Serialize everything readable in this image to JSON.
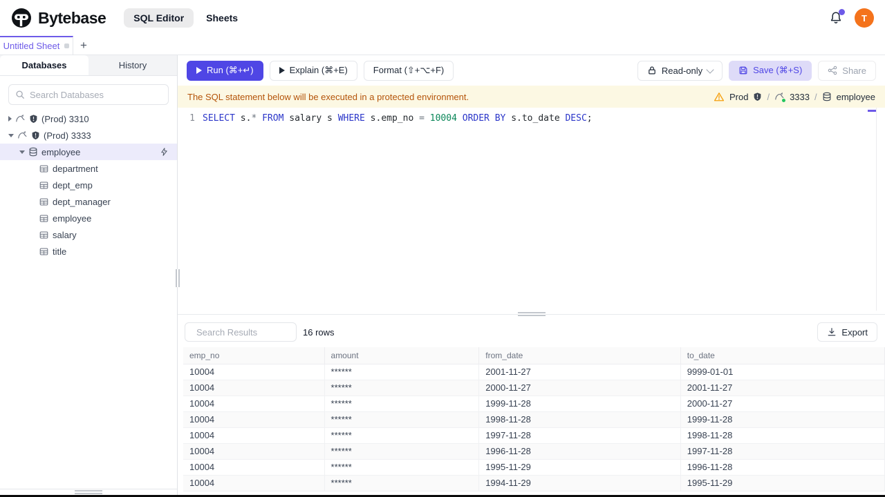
{
  "header": {
    "brand": "Bytebase",
    "nav": [
      {
        "label": "SQL Editor",
        "active": true
      },
      {
        "label": "Sheets",
        "active": false
      }
    ],
    "avatar_initial": "T"
  },
  "sheet_tabs": {
    "active_tab": "Untitled Sheet",
    "add_label": "+"
  },
  "sidebar": {
    "tabs": {
      "databases": "Databases",
      "history": "History"
    },
    "search_placeholder": "Search Databases",
    "instances": [
      {
        "label": "(Prod) 3310",
        "expanded": false
      },
      {
        "label": "(Prod) 3333",
        "expanded": true
      }
    ],
    "database": "employee",
    "tables": [
      "department",
      "dept_emp",
      "dept_manager",
      "employee",
      "salary",
      "title"
    ]
  },
  "toolbar": {
    "run_label": "Run (⌘+↵)",
    "explain_label": "Explain (⌘+E)",
    "format_label": "Format (⇧+⌥+F)",
    "mode_label": "Read-only",
    "save_label": "Save (⌘+S)",
    "share_label": "Share"
  },
  "banner": {
    "message": "The SQL statement below will be executed in a protected environment.",
    "environment": "Prod",
    "separator": "/",
    "instance": "3333",
    "database": "employee"
  },
  "editor": {
    "line_number": "1",
    "statement": "SELECT s.* FROM salary s WHERE s.emp_no = 10004 ORDER BY s.to_date DESC;",
    "tokens": [
      {
        "text": "SELECT",
        "type": "keyword"
      },
      {
        "text": " s.",
        "type": "plain"
      },
      {
        "text": "*",
        "type": "operator"
      },
      {
        "text": " ",
        "type": "plain"
      },
      {
        "text": "FROM",
        "type": "keyword"
      },
      {
        "text": " salary s ",
        "type": "plain"
      },
      {
        "text": "WHERE",
        "type": "keyword"
      },
      {
        "text": " s.emp_no ",
        "type": "plain"
      },
      {
        "text": "=",
        "type": "operator"
      },
      {
        "text": " ",
        "type": "plain"
      },
      {
        "text": "10004",
        "type": "number"
      },
      {
        "text": " ",
        "type": "plain"
      },
      {
        "text": "ORDER BY",
        "type": "keyword"
      },
      {
        "text": " s.to_date ",
        "type": "plain"
      },
      {
        "text": "DESC",
        "type": "keyword"
      },
      {
        "text": ";",
        "type": "plain"
      }
    ]
  },
  "results": {
    "search_placeholder": "Search Results",
    "row_count": "16 rows",
    "export_label": "Export",
    "columns": [
      "emp_no",
      "amount",
      "from_date",
      "to_date"
    ],
    "rows": [
      [
        "10004",
        "******",
        "2001-11-27",
        "9999-01-01"
      ],
      [
        "10004",
        "******",
        "2000-11-27",
        "2001-11-27"
      ],
      [
        "10004",
        "******",
        "1999-11-28",
        "2000-11-27"
      ],
      [
        "10004",
        "******",
        "1998-11-28",
        "1999-11-28"
      ],
      [
        "10004",
        "******",
        "1997-11-28",
        "1998-11-28"
      ],
      [
        "10004",
        "******",
        "1996-11-28",
        "1997-11-28"
      ],
      [
        "10004",
        "******",
        "1995-11-29",
        "1996-11-28"
      ],
      [
        "10004",
        "******",
        "1994-11-29",
        "1995-11-29"
      ]
    ]
  },
  "colors": {
    "accent": "#4f46e5",
    "tab_purple": "#6d5ae8",
    "save_bg": "#dedbf8",
    "banner_bg": "#fcf8e3",
    "banner_text": "#b45309",
    "warning": "#f59e0b",
    "avatar_bg": "#f4731c",
    "selected_row_bg": "#ecebfb",
    "sql_keyword": "#2b36c9",
    "sql_number": "#098658",
    "status_green": "#22c55e"
  }
}
